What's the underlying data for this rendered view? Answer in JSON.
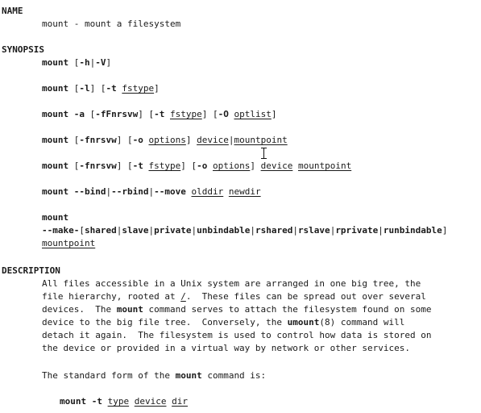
{
  "sections": {
    "name_heading": "NAME",
    "synopsis_heading": "SYNOPSIS",
    "description_heading": "DESCRIPTION"
  },
  "name_line": "mount - mount a filesystem",
  "synopsis": {
    "l1": {
      "cmd": "mount",
      "args": " [",
      "h": "-h",
      "bar": "|",
      "v": "-V",
      "end": "]"
    },
    "l2": {
      "cmd": "mount",
      "o1": " [",
      "l": "-l",
      "c1": "] [",
      "t": "-t",
      "sp": " ",
      "fstype": "fstype",
      "c2": "]"
    },
    "l3": {
      "cmd": "mount",
      "sp1": " ",
      "a": "-a",
      "o1": " [",
      "f": "-fFnrsvw",
      "c1": "] [",
      "t": "-t",
      "sp2": " ",
      "fstype": "fstype",
      "c2": "] [",
      "o": "-O",
      "sp3": " ",
      "optlist": "optlist",
      "c3": "]"
    },
    "l4": {
      "cmd": "mount",
      "o1": " [",
      "f": "-fnrsvw",
      "c1": "] [",
      "o": "-o",
      "sp": " ",
      "options": "options",
      "c2": "] ",
      "device": "device",
      "bar": "|",
      "mountpoint": "mountpoint"
    },
    "l5": {
      "cmd": "mount",
      "o1": " [",
      "f": "-fnrsvw",
      "c1": "] [",
      "t": "-t",
      "sp1": " ",
      "fstype": "fstype",
      "c2": "] [",
      "o": "-o",
      "sp2": " ",
      "options": "options",
      "c3": "] ",
      "device": "device",
      "sp3": " ",
      "mountpoint": "mountpoint"
    },
    "l6": {
      "cmd": "mount",
      "sp1": " ",
      "bind": "--bind",
      "b1": "|",
      "rbind": "--rbind",
      "b2": "|",
      "move": "--move",
      "sp2": " ",
      "olddir": "olddir",
      "sp3": " ",
      "newdir": "newdir"
    },
    "l7": {
      "cmd": "mount"
    },
    "l8": {
      "make": "--make-",
      "o": "[",
      "shared": "shared",
      "b1": "|",
      "slave": "slave",
      "b2": "|",
      "private": "private",
      "b3": "|",
      "unbindable": "unbindable",
      "b4": "|",
      "rshared": "rshared",
      "b5": "|",
      "rslave": "rslave",
      "b6": "|",
      "rprivate": "rprivate",
      "b7": "|",
      "runbindable": "runbindable",
      "c": "]"
    },
    "l9": {
      "mountpoint": "mountpoint"
    }
  },
  "description": {
    "p1_l1": "All files accessible in a Unix system are arranged in one big tree, the",
    "p1_l2a": "file hierarchy, rooted at ",
    "p1_l2_root": "/",
    "p1_l2b": ".  These files can be spread out over several",
    "p1_l3a": "devices.  The ",
    "p1_l3_mount": "mount",
    "p1_l3b": " command serves to attach the filesystem found on some",
    "p1_l4a": "device to the big file tree.  Conversely, the ",
    "p1_l4_umount": "umount",
    "p1_l4b": "(8) command will",
    "p1_l5": "detach it again.  The filesystem is used to control how data is stored on",
    "p1_l6": "the device or provided in a virtual way by network or other services.",
    "p2a": "The standard form of the ",
    "p2_mount": "mount",
    "p2b": " command is:",
    "ex_cmd": "mount -t",
    "ex_sp1": " ",
    "ex_type": "type",
    "ex_sp2": " ",
    "ex_device": "device",
    "ex_sp3": " ",
    "ex_dir": "dir"
  }
}
